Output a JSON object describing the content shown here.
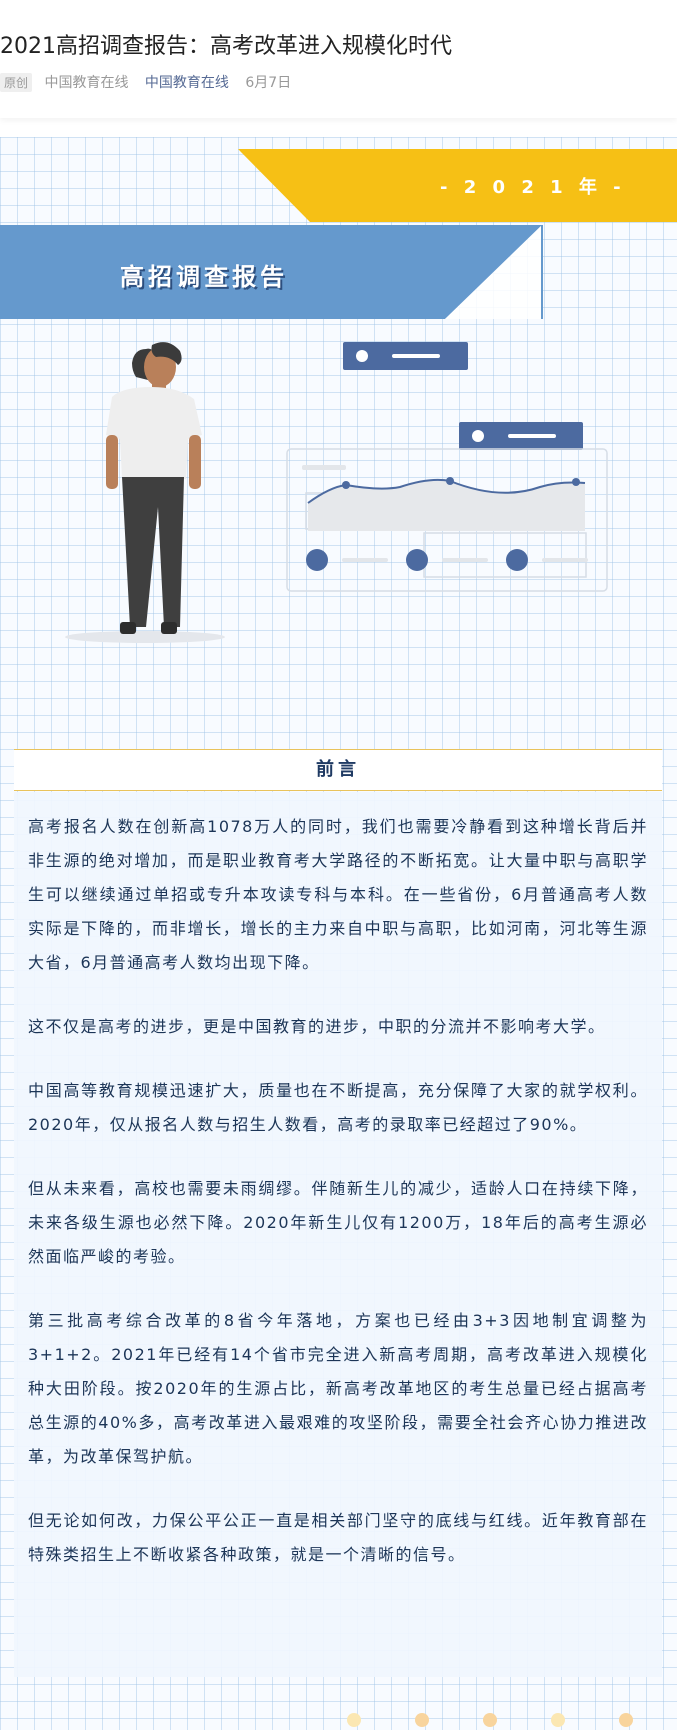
{
  "article": {
    "title": "2021高招调查报告：高考改革进入规模化时代",
    "tag": "原创",
    "source": "中国教育在线",
    "account": "中国教育在线",
    "date": "6月7日"
  },
  "banner": {
    "year": "- 2 0 2 1 年 -",
    "title": "高招调查报告",
    "colors": {
      "yellow": "#f6c015",
      "blue": "#6599cd",
      "dark_blue": "#4c6aa0"
    }
  },
  "section": {
    "heading": "前言"
  },
  "paragraphs": [
    "高考报名人数在创新高1078万人的同时，我们也需要冷静看到这种增长背后并非生源的绝对增加，而是职业教育考大学路径的不断拓宽。让大量中职与高职学生可以继续通过单招或专升本攻读专科与本科。在一些省份，6月普通高考人数实际是下降的，而非增长，增长的主力来自中职与高职，比如河南，河北等生源大省，6月普通高考人数均出现下降。",
    "这不仅是高考的进步，更是中国教育的进步，中职的分流并不影响考大学。",
    "中国高等教育规模迅速扩大，质量也在不断提高，充分保障了大家的就学权利。2020年，仅从报名人数与招生人数看，高考的录取率已经超过了90%。",
    "但从未来看，高校也需要未雨绸缪。伴随新生儿的减少，适龄人口在持续下降，未来各级生源也必然下降。2020年新生儿仅有1200万，18年后的高考生源必然面临严峻的考验。",
    "第三批高考综合改革的8省今年落地，方案也已经由3+3因地制宜调整为3+1+2。2021年已经有14个省市完全进入新高考周期，高考改革进入规模化种大田阶段。按2020年的生源占比，新高考改革地区的考生总量已经占据高考总生源的40%多，高考改革进入最艰难的攻坚阶段，需要全社会齐心协力推进改革，为改革保驾护航。",
    "但无论如何改，力保公平公正一直是相关部门坚守的底线与红线。近年教育部在特殊类招生上不断收紧各种政策，就是一个清晰的信号。"
  ]
}
